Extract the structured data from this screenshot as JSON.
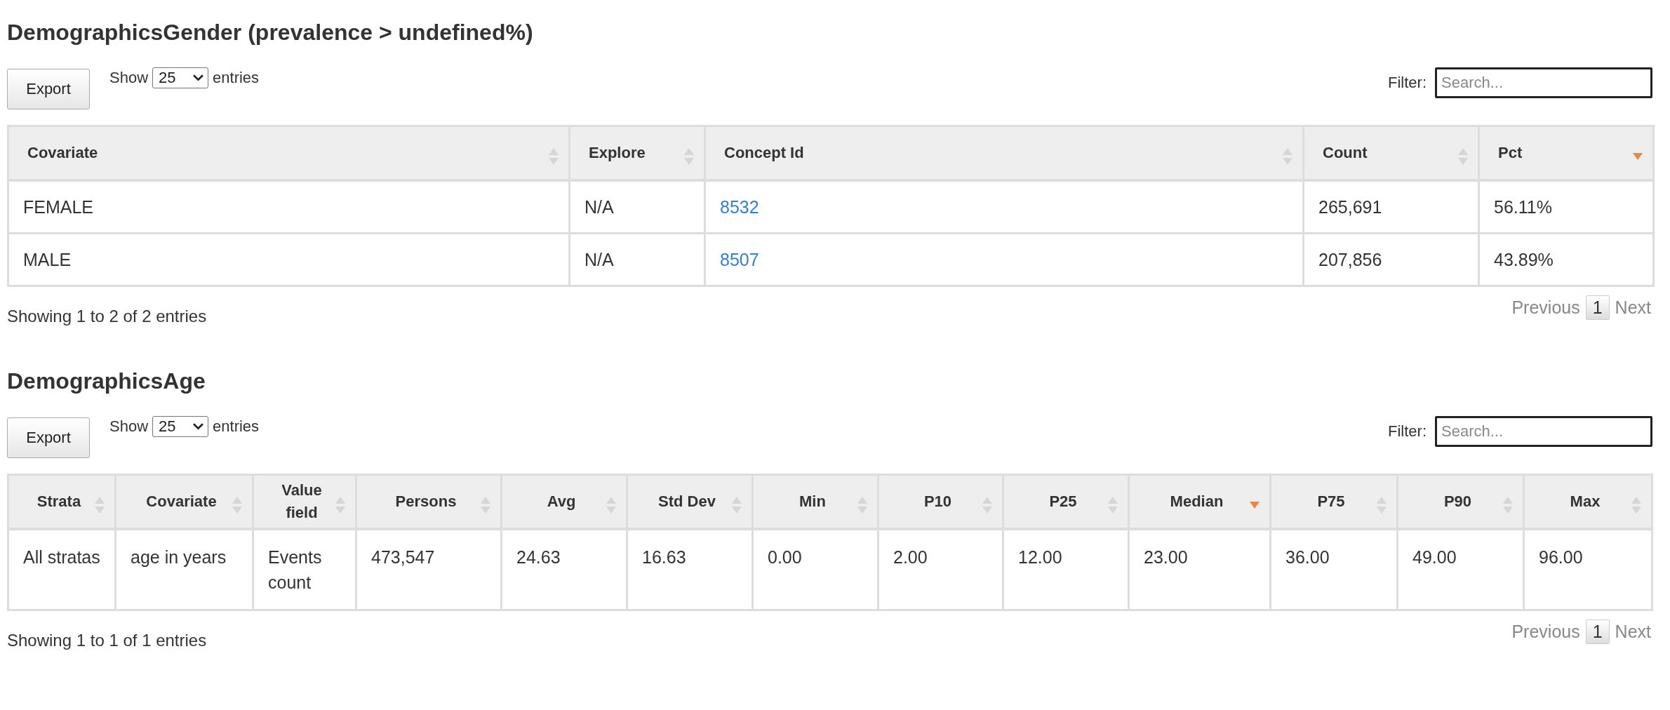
{
  "sections": [
    {
      "title": "DemographicsGender (prevalence > undefined%)",
      "export_label": "Export",
      "length": {
        "prefix": "Show",
        "value": "25",
        "suffix": "entries"
      },
      "filter": {
        "label": "Filter:",
        "placeholder": "Search..."
      },
      "table": {
        "columns": [
          {
            "label": "Covariate",
            "sorted": false
          },
          {
            "label": "Explore",
            "sorted": false
          },
          {
            "label": "Concept Id",
            "sorted": false
          },
          {
            "label": "Count",
            "sorted": false
          },
          {
            "label": "Pct",
            "sorted": true
          }
        ],
        "rows": [
          [
            {
              "text": "FEMALE"
            },
            {
              "text": "N/A"
            },
            {
              "text": "8532",
              "link": true
            },
            {
              "text": "265,691"
            },
            {
              "text": "56.11%"
            }
          ],
          [
            {
              "text": "MALE"
            },
            {
              "text": "N/A"
            },
            {
              "text": "8507",
              "link": true
            },
            {
              "text": "207,856"
            },
            {
              "text": "43.89%"
            }
          ]
        ]
      },
      "info": "Showing 1 to 2 of 2 entries",
      "pagination": [
        {
          "label": "Previous",
          "kind": "nav",
          "disabled": true
        },
        {
          "label": "1",
          "kind": "page",
          "selected": true
        },
        {
          "label": "Next",
          "kind": "nav",
          "disabled": true
        }
      ]
    },
    {
      "title": "DemographicsAge",
      "export_label": "Export",
      "length": {
        "prefix": "Show",
        "value": "25",
        "suffix": "entries"
      },
      "filter": {
        "label": "Filter:",
        "placeholder": "Search..."
      },
      "table": {
        "columns": [
          {
            "label": "Strata",
            "sorted": false
          },
          {
            "label": "Covariate",
            "sorted": false
          },
          {
            "label": "Value field",
            "sorted": false
          },
          {
            "label": "Persons",
            "sorted": false
          },
          {
            "label": "Avg",
            "sorted": false
          },
          {
            "label": "Std Dev",
            "sorted": false
          },
          {
            "label": "Min",
            "sorted": false
          },
          {
            "label": "P10",
            "sorted": false
          },
          {
            "label": "P25",
            "sorted": false
          },
          {
            "label": "Median",
            "sorted": true
          },
          {
            "label": "P75",
            "sorted": false
          },
          {
            "label": "P90",
            "sorted": false
          },
          {
            "label": "Max",
            "sorted": false
          }
        ],
        "rows": [
          [
            {
              "text": "All stratas"
            },
            {
              "text": "age in years"
            },
            {
              "text": "Events count"
            },
            {
              "text": "473,547"
            },
            {
              "text": "24.63"
            },
            {
              "text": "16.63"
            },
            {
              "text": "0.00"
            },
            {
              "text": "2.00"
            },
            {
              "text": "12.00"
            },
            {
              "text": "23.00"
            },
            {
              "text": "36.00"
            },
            {
              "text": "49.00"
            },
            {
              "text": "96.00"
            }
          ]
        ]
      },
      "info": "Showing 1 to 1 of 1 entries",
      "pagination": [
        {
          "label": "Previous",
          "kind": "nav",
          "disabled": true
        },
        {
          "label": "1",
          "kind": "page",
          "selected": true
        },
        {
          "label": "Next",
          "kind": "nav",
          "disabled": true
        }
      ]
    }
  ]
}
